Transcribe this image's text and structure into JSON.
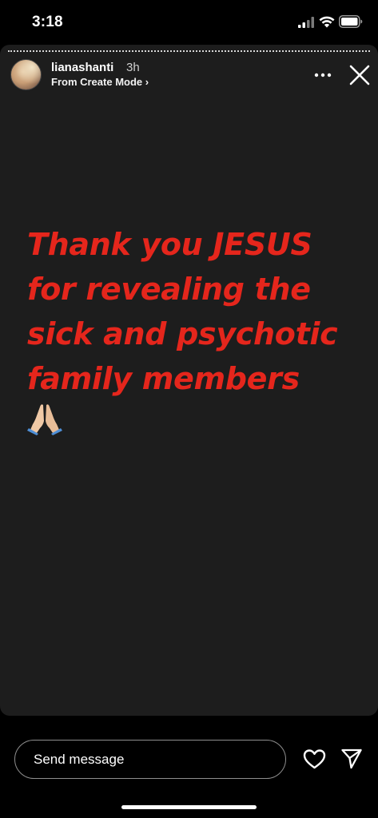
{
  "status_bar": {
    "time": "3:18",
    "icons": [
      "cellular-signal-icon",
      "wifi-icon",
      "battery-icon"
    ]
  },
  "story": {
    "username": "lianashanti",
    "time_ago": "3h",
    "source": "From Create Mode ›",
    "text": "Thank you JESUS for revealing the sick and psychotic family members",
    "emoji": "🙏🏼",
    "text_color": "#e5261c",
    "background": "#1d1d1d"
  },
  "reply": {
    "placeholder": "Send message"
  },
  "icons": {
    "more": "more-options-icon",
    "close": "close-icon",
    "heart": "heart-icon",
    "share": "paper-plane-icon"
  }
}
